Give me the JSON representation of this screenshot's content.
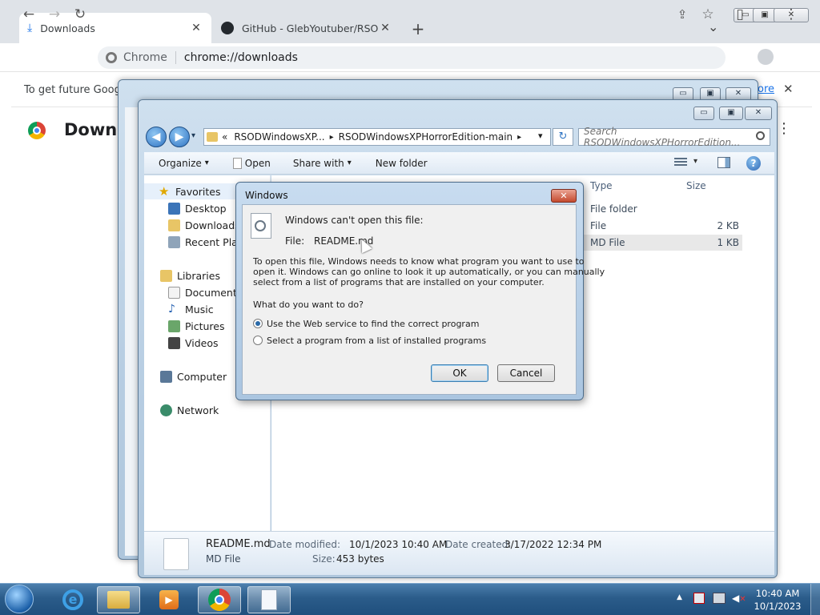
{
  "chrome": {
    "tabs": [
      {
        "title": "Downloads",
        "close": "✕"
      },
      {
        "title": "GitHub - GlebYoutuber/RSODWi",
        "close": "✕"
      }
    ],
    "new_tab": "+",
    "tab_menu": "⌄",
    "window_controls": {
      "minimize": "▭",
      "maximize": "▣",
      "close": "✕"
    },
    "nav": {
      "back": "←",
      "forward": "→",
      "reload": "↻"
    },
    "omnibox": {
      "chip": "Chrome",
      "url": "chrome://downloads"
    },
    "actions": {
      "share": "⇪",
      "bookmark": "☆",
      "side_panel": "▯",
      "menu": "⋮"
    },
    "infobar": {
      "text": "To get future Google",
      "link": "ore",
      "close": "✕"
    },
    "page_title": "Downlo",
    "page_menu": "⋮"
  },
  "explorer": {
    "back_window_controls": {
      "minimize": "▭",
      "maximize": "▣",
      "close": "✕"
    },
    "window_controls": {
      "minimize": "▭",
      "maximize": "▣",
      "close": "✕"
    },
    "address": {
      "overflow": "«",
      "seg1": "RSODWindowsXP...",
      "sep1": "▸",
      "seg2": "RSODWindowsXPHorrorEdition-main",
      "sep2": "▸",
      "dropdown": "▾",
      "refresh": "↻"
    },
    "search_placeholder": "Search RSODWindowsXPHorrorEdition...",
    "toolbar": {
      "organize": "Organize",
      "open": "Open",
      "share_with": "Share with",
      "new_folder": "New folder",
      "arrow": "▾",
      "help": "?"
    },
    "nav": {
      "favorites": "Favorites",
      "desktop": "Desktop",
      "downloads": "Downloads",
      "recent": "Recent Place",
      "libraries": "Libraries",
      "documents": "Documents",
      "music": "Music",
      "pictures": "Pictures",
      "videos": "Videos",
      "computer": "Computer",
      "network": "Network"
    },
    "columns": {
      "type": "Type",
      "size": "Size"
    },
    "rows": [
      {
        "type": "File folder",
        "size": ""
      },
      {
        "type": "File",
        "size": "2 KB"
      },
      {
        "type": "MD File",
        "size": "1 KB"
      }
    ],
    "details": {
      "name": "README.md",
      "kind": "MD File",
      "modified_label": "Date modified:",
      "modified": "10/1/2023 10:40 AM",
      "created_label": "Date created:",
      "created": "3/17/2022 12:34 PM",
      "size_label": "Size:",
      "size": "453 bytes"
    }
  },
  "dialog": {
    "title": "Windows",
    "close": "✕",
    "heading": "Windows can't open this file:",
    "file_label": "File:",
    "file_name": "README.md",
    "message_1": "To open this file, Windows needs to know what program you want to use to",
    "message_2": "open it. Windows can go online to look it up automatically, or you can manually",
    "message_3": "select from a list of programs that are installed on your computer.",
    "question": "What do you want to do?",
    "option_web": "Use the Web service to find the correct program",
    "option_list": "Select a program from a list of installed programs",
    "ok": "OK",
    "cancel": "Cancel"
  },
  "taskbar": {
    "tray_arrow": "▲",
    "time": "10:40 AM",
    "date": "10/1/2023"
  }
}
